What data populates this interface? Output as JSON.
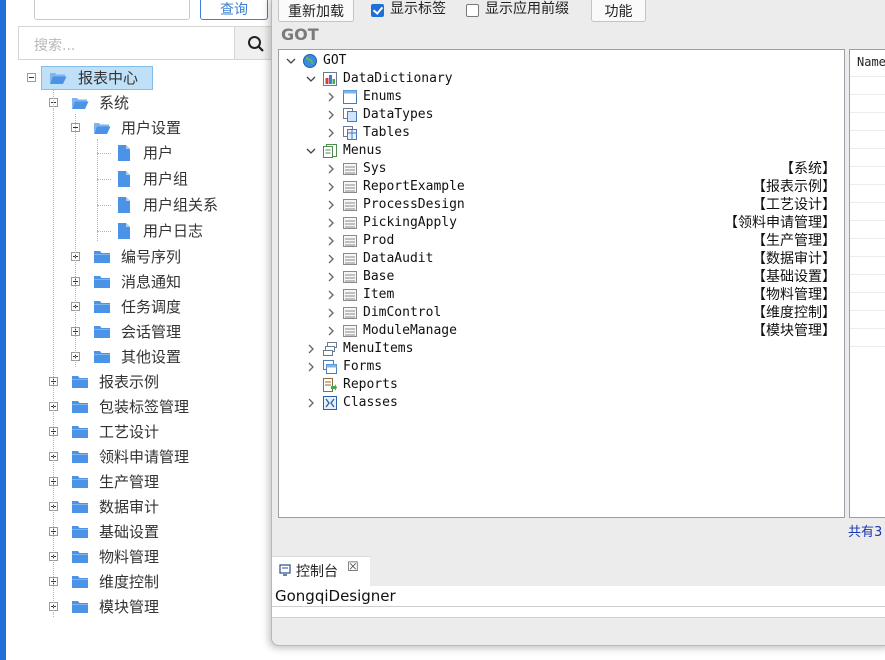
{
  "left_panel": {
    "query_button_label": "查询",
    "search_placeholder": "搜索...",
    "tree": [
      {
        "label": "报表中心",
        "selected": true
      },
      {
        "label": "系统"
      },
      {
        "label": "用户设置"
      },
      {
        "label": "用户"
      },
      {
        "label": "用户组"
      },
      {
        "label": "用户组关系"
      },
      {
        "label": "用户日志"
      },
      {
        "label": "编号序列"
      },
      {
        "label": "消息通知"
      },
      {
        "label": "任务调度"
      },
      {
        "label": "会话管理"
      },
      {
        "label": "其他设置"
      },
      {
        "label": "报表示例"
      },
      {
        "label": "包装标签管理"
      },
      {
        "label": "工艺设计"
      },
      {
        "label": "领料申请管理"
      },
      {
        "label": "生产管理"
      },
      {
        "label": "数据审计"
      },
      {
        "label": "基础设置"
      },
      {
        "label": "物料管理"
      },
      {
        "label": "维度控制"
      },
      {
        "label": "模块管理"
      }
    ]
  },
  "toolbar": {
    "reload_label": "重新加载",
    "show_labels_label": "显示标签",
    "show_labels_checked": true,
    "show_prefix_label": "显示应用前缀",
    "show_prefix_checked": false,
    "functions_label": "功能"
  },
  "editor": {
    "title": "GOT",
    "tree": [
      {
        "label": "GOT",
        "caption": ""
      },
      {
        "label": "DataDictionary",
        "caption": ""
      },
      {
        "label": "Enums",
        "caption": ""
      },
      {
        "label": "DataTypes",
        "caption": ""
      },
      {
        "label": "Tables",
        "caption": ""
      },
      {
        "label": "Menus",
        "caption": ""
      },
      {
        "label": "Sys",
        "caption": "【系统】"
      },
      {
        "label": "ReportExample",
        "caption": "【报表示例】"
      },
      {
        "label": "ProcessDesign",
        "caption": "【工艺设计】"
      },
      {
        "label": "PickingApply",
        "caption": "【领料申请管理】"
      },
      {
        "label": "Prod",
        "caption": "【生产管理】"
      },
      {
        "label": "DataAudit",
        "caption": "【数据审计】"
      },
      {
        "label": "Base",
        "caption": "【基础设置】"
      },
      {
        "label": "Item",
        "caption": "【物料管理】"
      },
      {
        "label": "DimControl",
        "caption": "【维度控制】"
      },
      {
        "label": "ModuleManage",
        "caption": "【模块管理】"
      },
      {
        "label": "MenuItems",
        "caption": ""
      },
      {
        "label": "Forms",
        "caption": ""
      },
      {
        "label": "Reports",
        "caption": ""
      },
      {
        "label": "Classes",
        "caption": ""
      }
    ],
    "properties_header": "Name",
    "count_text": "共有3"
  },
  "console": {
    "tab_label": "控制台",
    "tab_close": "☒",
    "output": "GongqiDesigner"
  }
}
